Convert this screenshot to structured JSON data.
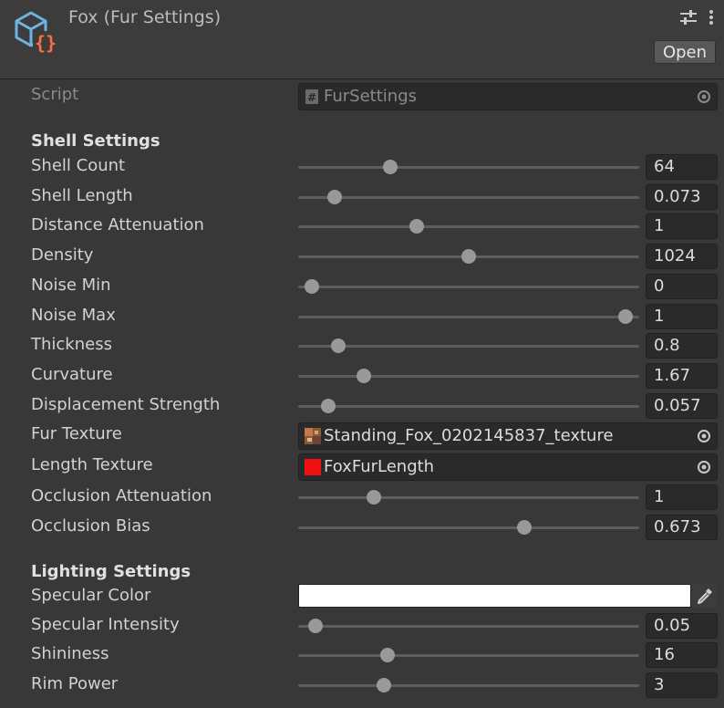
{
  "header": {
    "title": "Fox (Fur Settings)",
    "open_label": "Open"
  },
  "script_row": {
    "label": "Script",
    "value": "FurSettings"
  },
  "shell_section": {
    "title": "Shell Settings"
  },
  "shell": {
    "shell_count": {
      "label": "Shell Count",
      "value": "64",
      "fraction": 0.26
    },
    "shell_length": {
      "label": "Shell Length",
      "value": "0.073",
      "fraction": 0.09
    },
    "distance_attenuation": {
      "label": "Distance Attenuation",
      "value": "1",
      "fraction": 0.34
    },
    "density": {
      "label": "Density",
      "value": "1024",
      "fraction": 0.5
    },
    "noise_min": {
      "label": "Noise Min",
      "value": "0",
      "fraction": 0.02
    },
    "noise_max": {
      "label": "Noise Max",
      "value": "1",
      "fraction": 0.98
    },
    "thickness": {
      "label": "Thickness",
      "value": "0.8",
      "fraction": 0.1
    },
    "curvature": {
      "label": "Curvature",
      "value": "1.67",
      "fraction": 0.18
    },
    "displacement_strength": {
      "label": "Displacement Strength",
      "value": "0.057",
      "fraction": 0.07
    },
    "fur_texture": {
      "label": "Fur Texture",
      "value": "Standing_Fox_0202145837_texture"
    },
    "length_texture": {
      "label": "Length Texture",
      "value": "FoxFurLength"
    },
    "occlusion_attenuation": {
      "label": "Occlusion Attenuation",
      "value": "1",
      "fraction": 0.21
    },
    "occlusion_bias": {
      "label": "Occlusion Bias",
      "value": "0.673",
      "fraction": 0.67
    }
  },
  "lighting_section": {
    "title": "Lighting Settings"
  },
  "lighting": {
    "specular_color": {
      "label": "Specular Color",
      "color": "#ffffff"
    },
    "specular_intensity": {
      "label": "Specular Intensity",
      "value": "0.05",
      "fraction": 0.03
    },
    "shininess": {
      "label": "Shininess",
      "value": "16",
      "fraction": 0.25
    },
    "rim_power": {
      "label": "Rim Power",
      "value": "3",
      "fraction": 0.24
    }
  }
}
